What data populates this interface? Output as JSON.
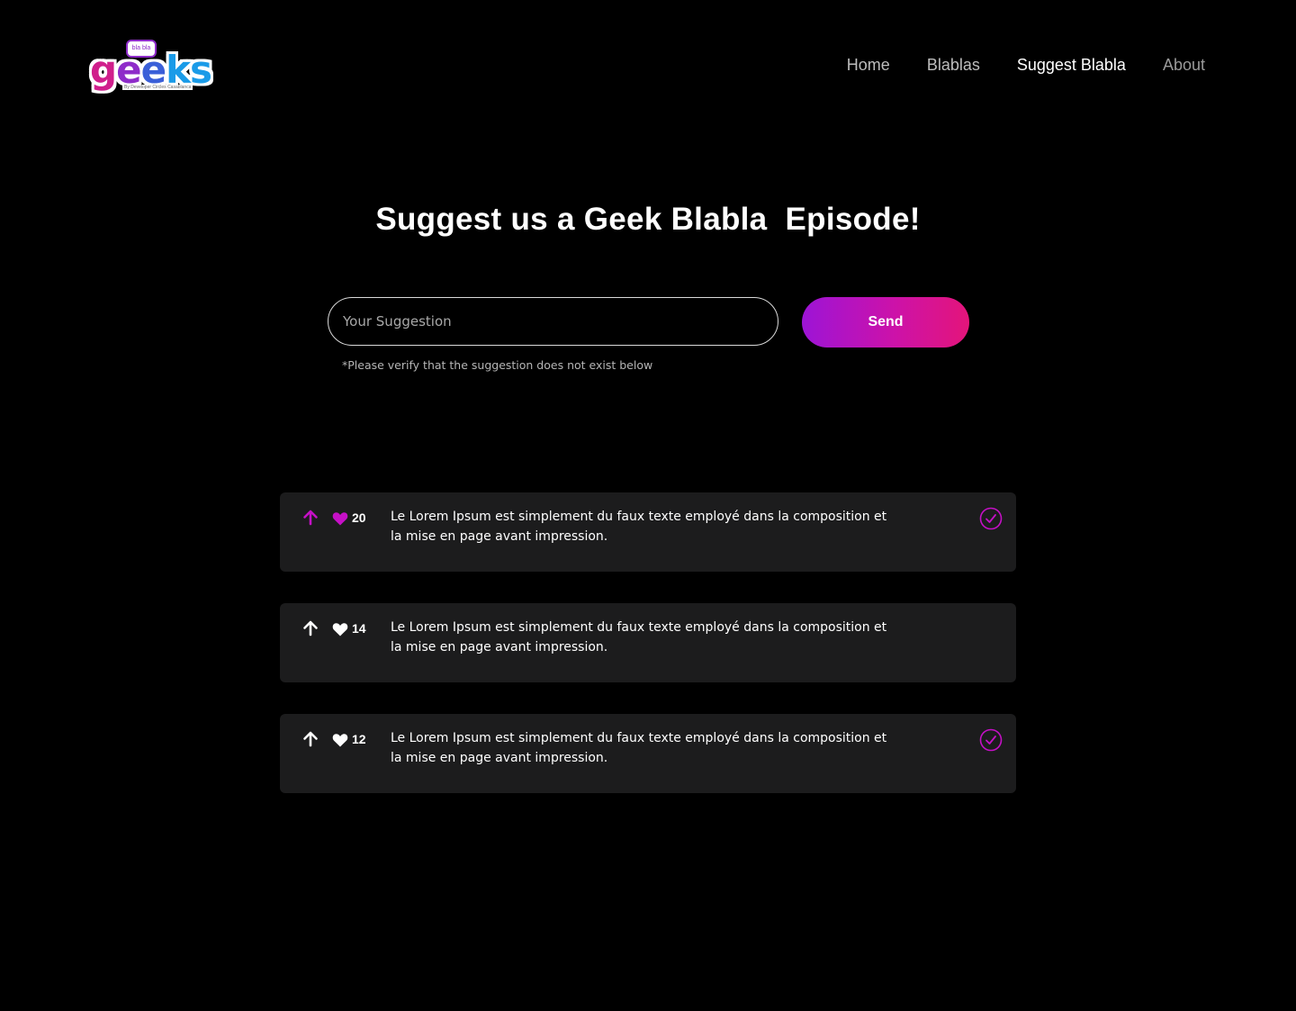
{
  "brand": {
    "logo_text": "geeks",
    "logo_bubble": "bla bla",
    "logo_sub": "By Developer Circles Casablanca"
  },
  "nav": {
    "items": [
      {
        "label": "Home",
        "state": "normal"
      },
      {
        "label": "Blablas",
        "state": "normal"
      },
      {
        "label": "Suggest Blabla",
        "state": "active"
      },
      {
        "label": "About",
        "state": "dim"
      }
    ]
  },
  "page": {
    "title": "Suggest us a Geek Blabla  Episode!"
  },
  "form": {
    "placeholder": "Your Suggestion",
    "send_label": "Send",
    "hint": "*Please verify that the suggestion does not exist below"
  },
  "suggestions": [
    {
      "likes": "20",
      "text": "Le Lorem Ipsum est simplement du faux texte employé dans la composition et la mise en page avant impression.",
      "upvoted": true,
      "done": true
    },
    {
      "likes": "14",
      "text": "Le Lorem Ipsum est simplement du faux texte employé dans la composition et la mise en page avant impression.",
      "upvoted": false,
      "done": false
    },
    {
      "likes": "12",
      "text": "Le Lorem Ipsum est simplement du faux texte employé dans la composition et la mise en page avant impression.",
      "upvoted": false,
      "done": true
    }
  ],
  "colors": {
    "accent": "#c510c6",
    "card_bg": "#1c1c1d",
    "background": "#000000"
  }
}
